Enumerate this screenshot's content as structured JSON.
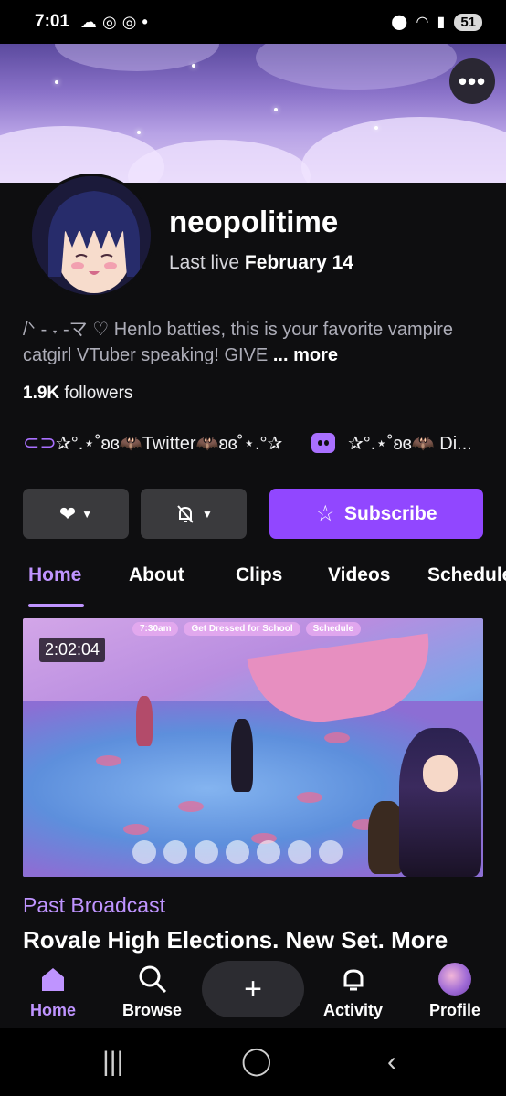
{
  "status_bar": {
    "time": "7:01",
    "left_icons": [
      "weather-icon",
      "threads-icon",
      "threads-icon",
      "dot"
    ],
    "battery": "51"
  },
  "banner": {
    "menu_label": "•••"
  },
  "channel": {
    "name": "neopolitime",
    "last_live_prefix": "Last live",
    "last_live_date": "February 14",
    "bio": "/ᐠ - ˕ -マ ♡ Henlo batties, this is your favorite vampire catgirl VTuber speaking! GIVE",
    "bio_more": "... more",
    "followers_count": "1.9K",
    "followers_label": "followers"
  },
  "links": [
    {
      "icon": "link-icon",
      "label": "✰°.⋆˚ʚ⁠ɞ🦇Twitter🦇ʚɞ˚⋆.°✰"
    },
    {
      "icon": "discord-icon",
      "label": "✰°.⋆˚ʚɞ🦇 Di..."
    }
  ],
  "actions": {
    "follow_icon": "heart-icon",
    "notify_icon": "bell-off-icon",
    "subscribe_label": "Subscribe"
  },
  "tabs": [
    "Home",
    "About",
    "Clips",
    "Videos",
    "Schedule"
  ],
  "active_tab": "Home",
  "video": {
    "duration": "2:02:04",
    "hud": [
      "7:30am",
      "Get Dressed for School",
      "Schedule"
    ],
    "category": "Past Broadcast",
    "title": "Rovale High Elections. New Set. More"
  },
  "bottom_nav": {
    "items": [
      {
        "label": "Home",
        "icon": "home-icon"
      },
      {
        "label": "Browse",
        "icon": "search-icon"
      },
      {
        "label": "Activity",
        "icon": "bell-icon"
      },
      {
        "label": "Profile",
        "icon": "profile-avatar"
      }
    ],
    "create_label": "+"
  },
  "colors": {
    "accent": "#bf94ff",
    "subscribe": "#9147ff",
    "background": "#0e0e10",
    "button_gray": "#3a3a3d"
  }
}
